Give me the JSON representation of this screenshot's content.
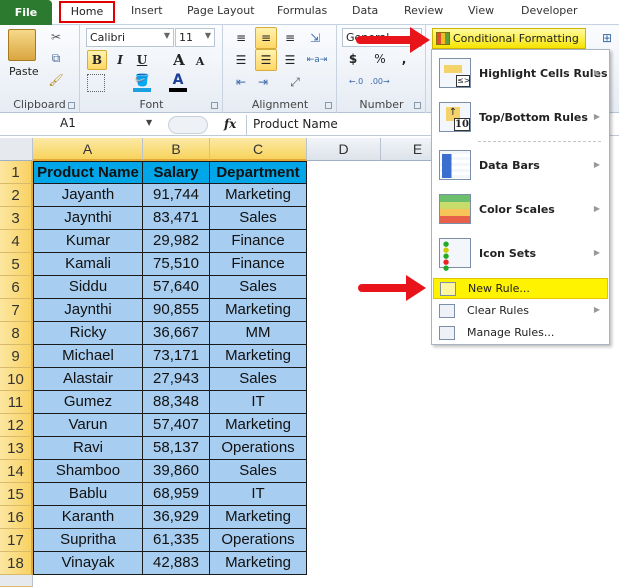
{
  "tabs": {
    "file": "File",
    "items": [
      "Home",
      "Insert",
      "Page Layout",
      "Formulas",
      "Data",
      "Review",
      "View",
      "Developer"
    ]
  },
  "ribbon": {
    "clipboard": {
      "label": "Clipboard",
      "paste": "Paste"
    },
    "font": {
      "label": "Font",
      "name": "Calibri",
      "size": "11",
      "bold": "B",
      "italic": "I",
      "underline": "U"
    },
    "alignment": {
      "label": "Alignment"
    },
    "number": {
      "label": "Number",
      "format": "General",
      "currency": "$",
      "percent": "%",
      "comma": ","
    },
    "conditional_formatting": "Conditional Formatting"
  },
  "formula_bar": {
    "name_box": "A1",
    "fx": "fx",
    "value": "Product Name"
  },
  "sheet": {
    "columns": [
      "A",
      "B",
      "C",
      "D",
      "E"
    ],
    "rows": [
      [
        "Product Name",
        "Salary",
        "Department"
      ],
      [
        "Jayanth",
        "91,744",
        "Marketing"
      ],
      [
        "Jaynthi",
        "83,471",
        "Sales"
      ],
      [
        "Kumar",
        "29,982",
        "Finance"
      ],
      [
        "Kamali",
        "75,510",
        "Finance"
      ],
      [
        "Siddu",
        "57,640",
        "Sales"
      ],
      [
        "Jaynthi",
        "90,855",
        "Marketing"
      ],
      [
        "Ricky",
        "36,667",
        "MM"
      ],
      [
        "Michael",
        "73,171",
        "Marketing"
      ],
      [
        "Alastair",
        "27,943",
        "Sales"
      ],
      [
        "Gumez",
        "88,348",
        "IT"
      ],
      [
        "Varun",
        "57,407",
        "Marketing"
      ],
      [
        "Ravi",
        "58,137",
        "Operations"
      ],
      [
        "Shamboo",
        "39,860",
        "Sales"
      ],
      [
        "Bablu",
        "68,959",
        "IT"
      ],
      [
        "Karanth",
        "36,929",
        "Marketing"
      ],
      [
        "Supritha",
        "61,335",
        "Operations"
      ],
      [
        "Vinayak",
        "42,883",
        "Marketing"
      ]
    ],
    "row_numbers": [
      "1",
      "2",
      "3",
      "4",
      "5",
      "6",
      "7",
      "8",
      "9",
      "10",
      "11",
      "12",
      "13",
      "14",
      "15",
      "16",
      "17",
      "18"
    ]
  },
  "menu": {
    "items": [
      {
        "label": "Highlight Cells Rules",
        "submenu": true
      },
      {
        "label": "Top/Bottom Rules",
        "submenu": true
      },
      {
        "label": "Data Bars",
        "submenu": true
      },
      {
        "label": "Color Scales",
        "submenu": true
      },
      {
        "label": "Icon Sets",
        "submenu": true
      },
      {
        "label": "New Rule...",
        "submenu": false,
        "highlighted": true
      },
      {
        "label": "Clear Rules",
        "submenu": true
      },
      {
        "label": "Manage Rules...",
        "submenu": false
      }
    ]
  },
  "colors": {
    "header_fill": "#00a6e8",
    "data_fill": "#a7cdf0",
    "highlight": "#fff300",
    "arrow": "#e8141a",
    "file_tab": "#2b7a2f"
  }
}
